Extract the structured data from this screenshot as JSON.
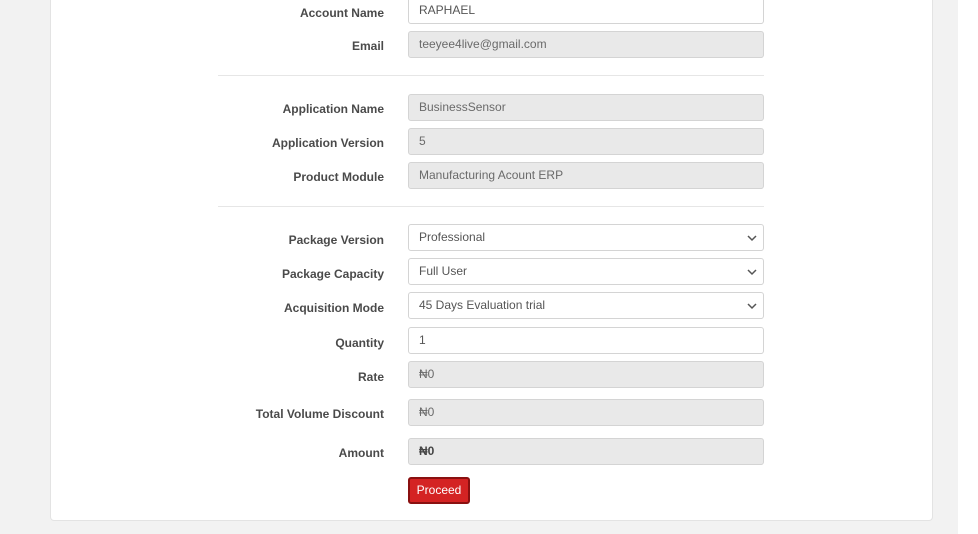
{
  "account": {
    "name_label": "Account Name",
    "name_value": "RAPHAEL",
    "email_label": "Email",
    "email_value": "teeyee4live@gmail.com"
  },
  "application": {
    "name_label": "Application Name",
    "name_value": "BusinessSensor",
    "version_label": "Application Version",
    "version_value": "5",
    "module_label": "Product Module",
    "module_value": "Manufacturing Acount ERP"
  },
  "package": {
    "version_label": "Package Version",
    "version_value": "Professional",
    "capacity_label": "Package Capacity",
    "capacity_value": "Full User",
    "acquisition_label": "Acquisition Mode",
    "acquisition_value": "45 Days Evaluation trial",
    "quantity_label": "Quantity",
    "quantity_value": "1",
    "rate_label": "Rate",
    "rate_value": "₦0",
    "discount_label": "Total Volume Discount",
    "discount_value": "₦0",
    "amount_label": "Amount",
    "amount_value": "₦0"
  },
  "actions": {
    "proceed_label": "Proceed"
  },
  "icons": {
    "select_arrow": "chevron-down-icon"
  },
  "colors": {
    "proceed_bg": "#d42323",
    "readonly_bg": "#e9e9e9"
  }
}
